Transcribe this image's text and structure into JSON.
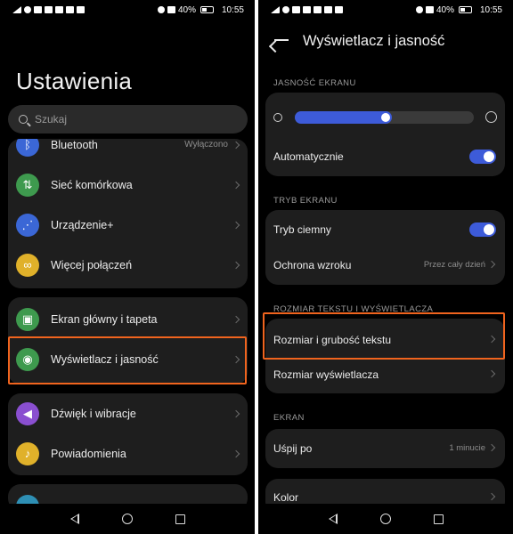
{
  "status_bar": {
    "left_icons": [
      "signal-icon",
      "wifi-icon",
      "instagram-icon",
      "facebook-icon",
      "twitter-icon",
      "linkedin-icon",
      "youtube-icon"
    ],
    "right_text": "40%",
    "time": "10:55"
  },
  "left_screen": {
    "title": "Ustawienia",
    "search": {
      "placeholder": "Szukaj"
    },
    "groups": [
      {
        "items": [
          {
            "label": "Bluetooth",
            "value": "Wyłączono",
            "icon": "bluetooth-icon",
            "color": "#3b67d6"
          },
          {
            "label": "Sieć komórkowa",
            "value": "",
            "icon": "mobile-data-icon",
            "color": "#3e9a4e"
          },
          {
            "label": "Urządzenie+",
            "value": "",
            "icon": "share-icon",
            "color": "#3b67d6"
          },
          {
            "label": "Więcej połączeń",
            "value": "",
            "icon": "link-icon",
            "color": "#e0b12a"
          }
        ]
      },
      {
        "items": [
          {
            "label": "Ekran główny i tapeta",
            "value": "",
            "icon": "image-icon",
            "color": "#3e9a4e"
          },
          {
            "label": "Wyświetlacz i jasność",
            "value": "",
            "icon": "eye-icon",
            "color": "#3e9a4e"
          }
        ]
      },
      {
        "items": [
          {
            "label": "Dźwięk i wibracje",
            "value": "",
            "icon": "speaker-icon",
            "color": "#8a4fd0"
          },
          {
            "label": "Powiadomienia",
            "value": "",
            "icon": "bell-icon",
            "color": "#e0b12a"
          }
        ]
      }
    ]
  },
  "right_screen": {
    "title": "Wyświetlacz i jasność",
    "brightness": {
      "section": "JASNOŚĆ EKRANU",
      "level": 0.54,
      "auto_label": "Automatycznie",
      "auto_on": true
    },
    "screen_mode": {
      "section": "TRYB EKRANU",
      "dark_label": "Tryb ciemny",
      "dark_on": true,
      "eye_label": "Ochrona wzroku",
      "eye_value": "Przez cały dzień"
    },
    "text_size": {
      "section": "ROZMIAR TEKSTU I WYŚWIETLACZA",
      "text_label": "Rozmiar i grubość tekstu",
      "display_label": "Rozmiar wyświetlacza"
    },
    "screen": {
      "section": "EKRAN",
      "sleep_label": "Uśpij po",
      "sleep_value": "1 minucie",
      "color_label": "Kolor"
    }
  },
  "colors": {
    "accent": "#3d5bd9",
    "highlight": "#f0641e"
  }
}
